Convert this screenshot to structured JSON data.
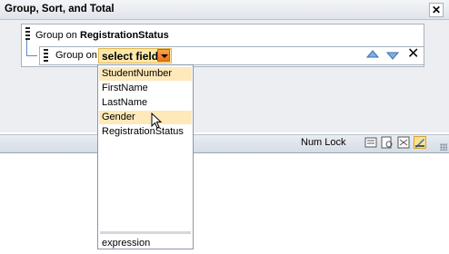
{
  "pane": {
    "title": "Group, Sort, and Total",
    "close_icon": "close-icon"
  },
  "group_level_1": {
    "label": "Group on",
    "field": "RegistrationStatus"
  },
  "group_level_2": {
    "label": "Group on",
    "field_placeholder": "select field"
  },
  "dropdown": {
    "items": [
      {
        "label": "StudentNumber",
        "highlighted": true
      },
      {
        "label": "FirstName",
        "highlighted": false
      },
      {
        "label": "LastName",
        "highlighted": false
      },
      {
        "label": "Gender",
        "highlighted": true
      },
      {
        "label": "RegistrationStatus",
        "highlighted": false
      }
    ],
    "footer": "expression"
  },
  "statusbar": {
    "num_lock": "Num Lock",
    "view_icons": [
      "form-view-icon",
      "print-preview-icon",
      "datasheet-icon",
      "design-view-icon"
    ]
  },
  "colors": {
    "select_bg": "#fde7a9",
    "highlight": "#fde9b9",
    "accent_arrow": "#e9731d"
  }
}
